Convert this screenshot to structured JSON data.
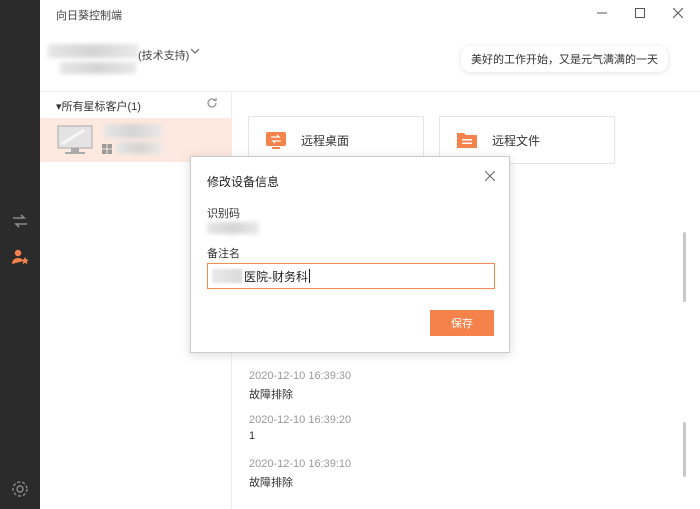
{
  "app": {
    "title": "向日葵控制端"
  },
  "account": {
    "suffix": "(技术支持)"
  },
  "greeting": "美好的工作开始，又是元气满满的一天",
  "device_list": {
    "group_title": "▾所有星标客户(1)"
  },
  "actions": [
    {
      "label": "远程桌面",
      "icon": "remote-desktop-icon",
      "color": "#f5824a"
    },
    {
      "label": "远程文件",
      "icon": "remote-file-icon",
      "color": "#f5824a"
    }
  ],
  "logs": [
    {
      "time": "2020-12-10 16:39:30",
      "text": "故障排除"
    },
    {
      "time": "2020-12-10 16:39:20",
      "text": "1"
    },
    {
      "time": "2020-12-10 16:39:10",
      "text": "故障排除"
    }
  ],
  "modal": {
    "title": "修改设备信息",
    "id_label": "识别码",
    "name_label": "备注名",
    "name_value": "医院-财务科",
    "save_label": "保存"
  },
  "colors": {
    "accent": "#f5824a",
    "rail": "#2b2b2b",
    "selected_row": "#fde9df"
  }
}
